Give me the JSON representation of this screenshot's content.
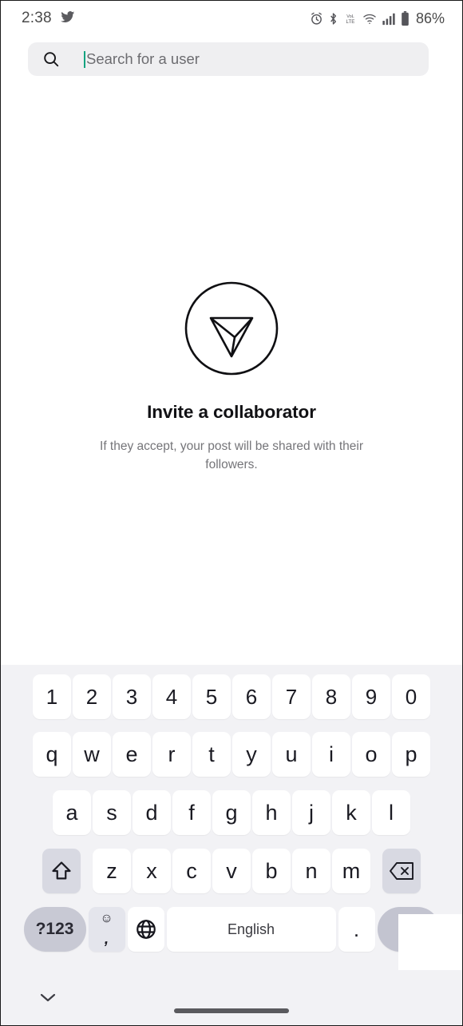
{
  "status_bar": {
    "time": "2:38",
    "app_icon": "twitter-bird-icon",
    "icons": [
      "alarm-clock-icon",
      "bluetooth-icon",
      "volte-icon",
      "wifi-icon",
      "cellular-signal-icon",
      "battery-icon"
    ],
    "battery_percent": "86%"
  },
  "search": {
    "icon": "search-icon",
    "placeholder": "Search for a user",
    "value": "",
    "caret_color": "#10a37f",
    "background": "#efeff1"
  },
  "empty_state": {
    "icon": "send-paper-plane-circle-icon",
    "title": "Invite a collaborator",
    "subtitle": "If they accept, your post will be shared with their followers."
  },
  "keyboard": {
    "row_numbers": [
      "1",
      "2",
      "3",
      "4",
      "5",
      "6",
      "7",
      "8",
      "9",
      "0"
    ],
    "row_top": [
      "q",
      "w",
      "e",
      "r",
      "t",
      "y",
      "u",
      "i",
      "o",
      "p"
    ],
    "row_home": [
      "a",
      "s",
      "d",
      "f",
      "g",
      "h",
      "j",
      "k",
      "l"
    ],
    "row_bottom": [
      "z",
      "x",
      "c",
      "v",
      "b",
      "n",
      "m"
    ],
    "shift_label": "shift-icon",
    "backspace_label": "backspace-icon",
    "symbols_label": "?123",
    "emoji_label": "☺",
    "comma_label": ",",
    "globe_label": "globe-icon",
    "space_label": "English",
    "period_label": ".",
    "enter_label": "checkmark-icon",
    "key_color": "#ffffff",
    "modifier_color": "#d8d9e2",
    "background": "#f2f2f5"
  },
  "nav_bar": {
    "hide_keyboard_icon": "chevron-down-icon",
    "home_indicator": "home-indicator"
  }
}
